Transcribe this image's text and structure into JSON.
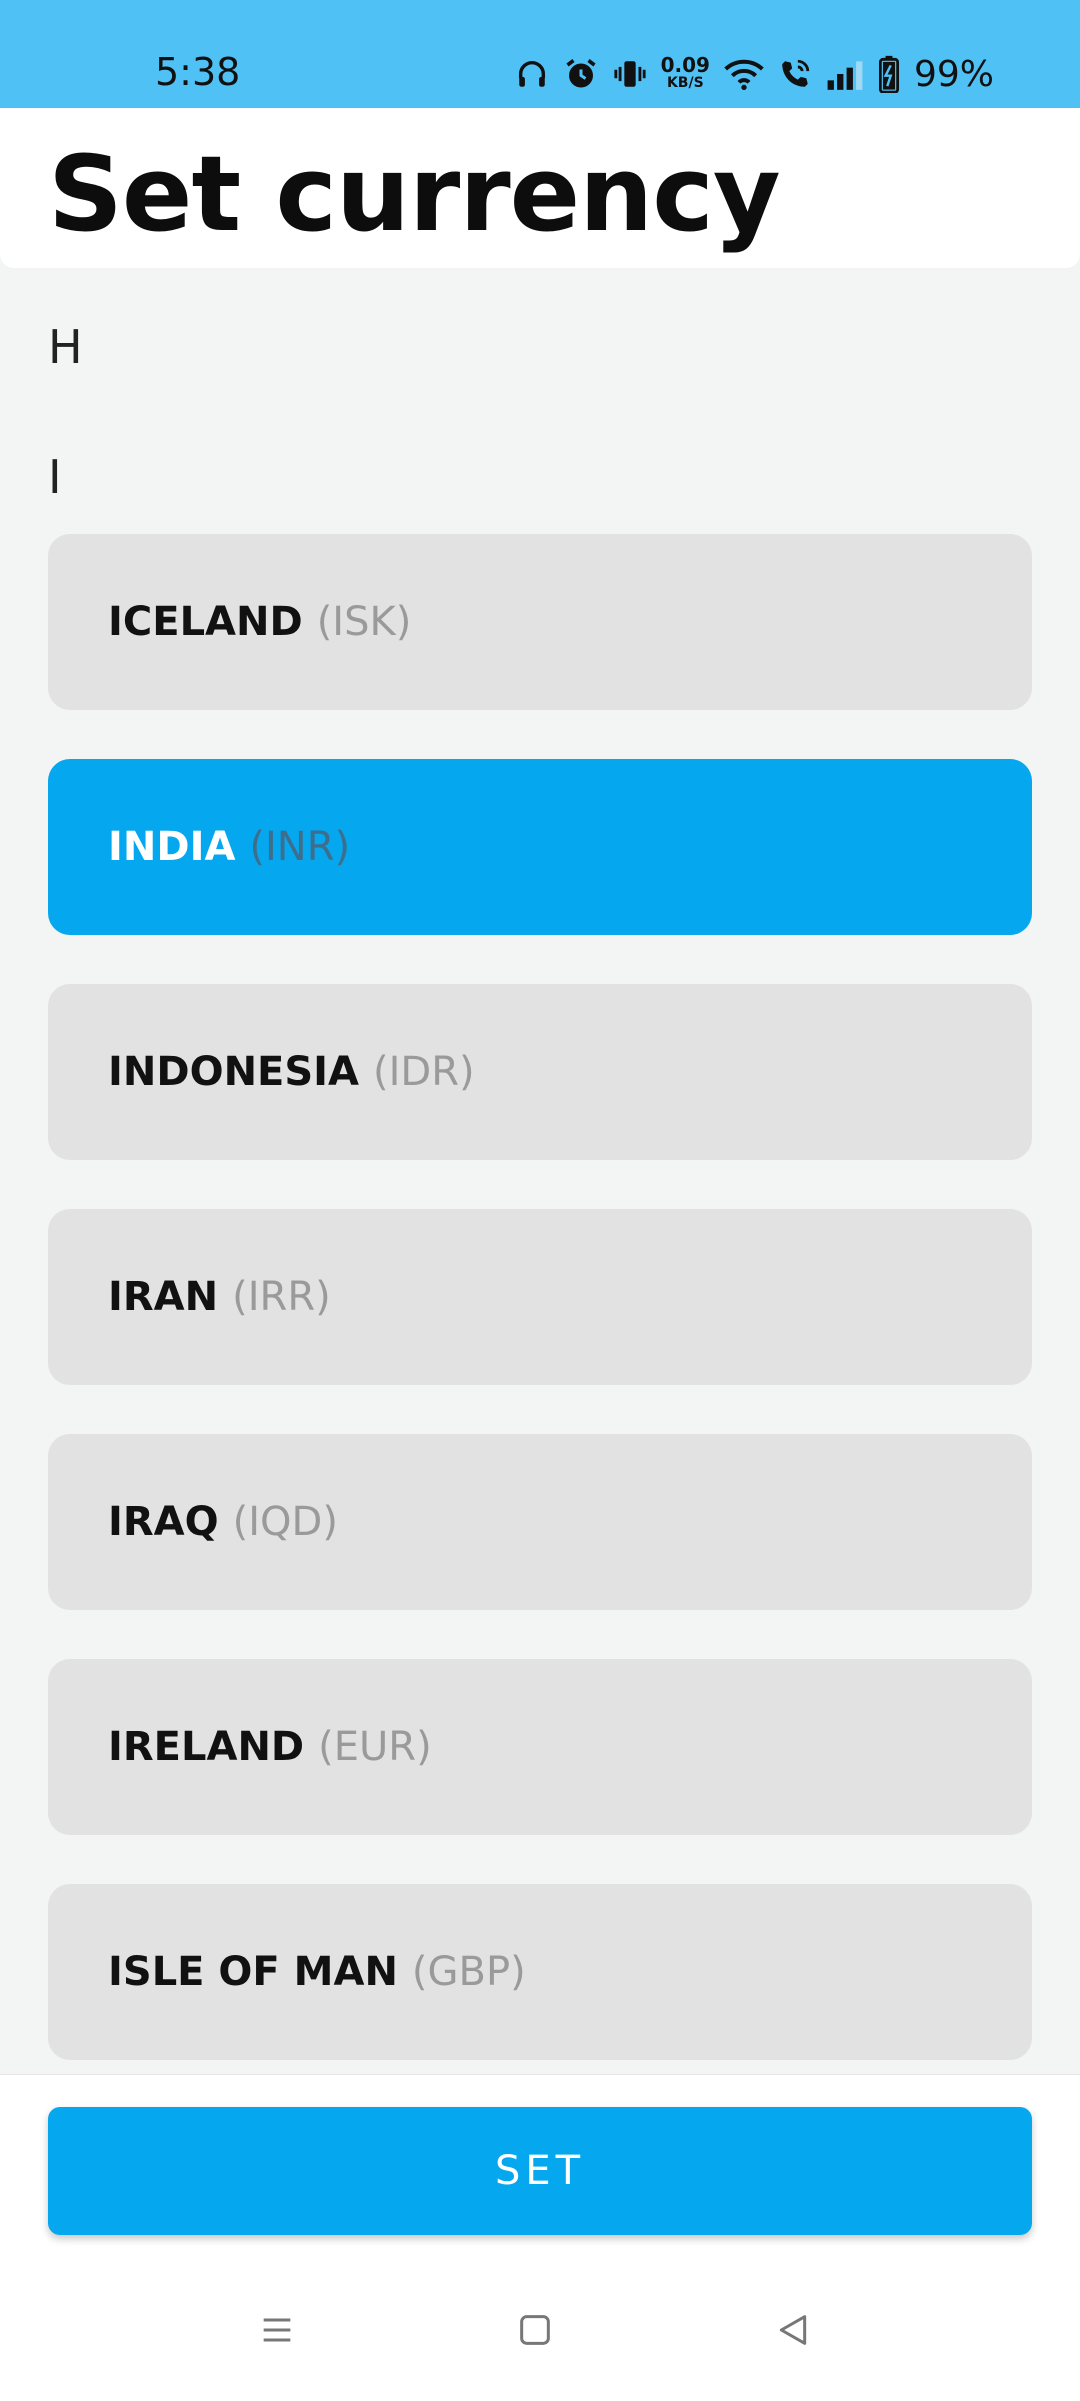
{
  "status_bar": {
    "time": "5:38",
    "net_speed_value": "0.09",
    "net_speed_unit": "KB/S",
    "battery": "99%",
    "icons": [
      "headphones-icon",
      "alarm-icon",
      "vibrate-icon",
      "wifi-icon",
      "wifi-call-icon",
      "signal-icon",
      "battery-charging-icon"
    ]
  },
  "header": {
    "title": "Set currency"
  },
  "sections": [
    {
      "letter": "H"
    },
    {
      "letter": "I"
    }
  ],
  "currencies": [
    {
      "country": "ICELAND",
      "code": "(ISK)",
      "selected": false
    },
    {
      "country": "INDIA",
      "code": "(INR)",
      "selected": true
    },
    {
      "country": "INDONESIA",
      "code": "(IDR)",
      "selected": false
    },
    {
      "country": "IRAN",
      "code": "(IRR)",
      "selected": false
    },
    {
      "country": "IRAQ",
      "code": "(IQD)",
      "selected": false
    },
    {
      "country": "IRELAND",
      "code": "(EUR)",
      "selected": false
    },
    {
      "country": "ISLE OF MAN",
      "code": "(GBP)",
      "selected": false
    }
  ],
  "footer": {
    "set_label": "SET"
  },
  "navbar": {
    "icons": [
      "menu-icon",
      "home-icon",
      "back-icon"
    ]
  },
  "colors": {
    "accent": "#05a7ef",
    "status_bar": "#50c1f5",
    "item_bg": "#e2e2e2",
    "page_bg": "#f3f4f4"
  }
}
